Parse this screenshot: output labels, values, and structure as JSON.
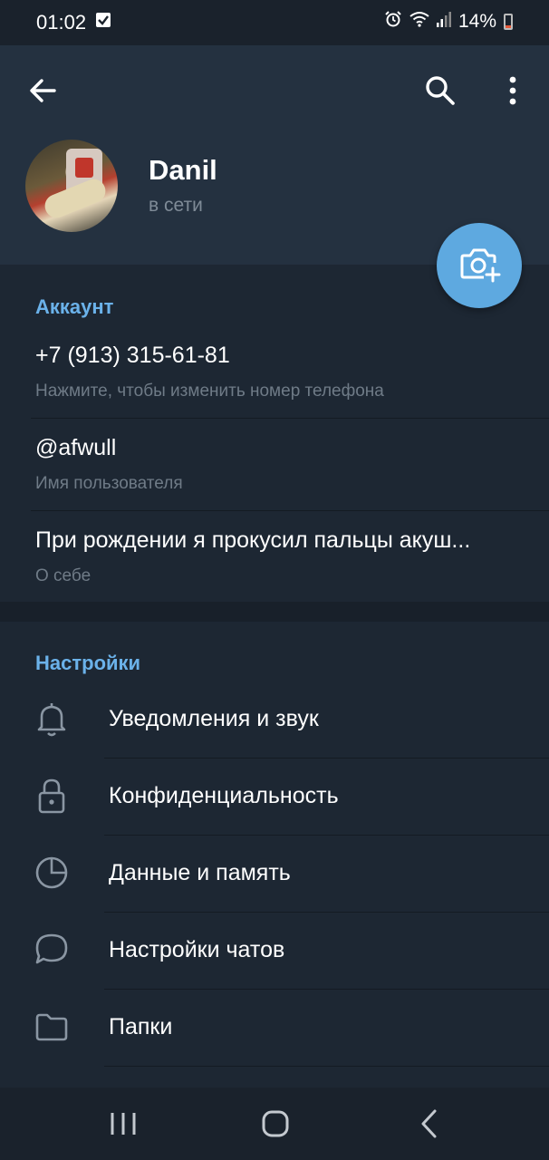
{
  "status_bar": {
    "time": "01:02",
    "battery": "14%",
    "icons": [
      "check-icon",
      "alarm-icon",
      "wifi-icon",
      "signal-icon",
      "battery-icon"
    ]
  },
  "header": {
    "icons": [
      "back-arrow-icon",
      "search-icon",
      "more-vert-icon"
    ],
    "name": "Danil",
    "status": "в сети",
    "fab_icon": "camera-add-icon"
  },
  "account": {
    "title": "Аккаунт",
    "rows": [
      {
        "value": "+7 (913) 315-61-81",
        "label": "Нажмите, чтобы изменить номер телефона"
      },
      {
        "value": "@afwull",
        "label": "Имя пользователя"
      },
      {
        "value": "При рождении я прокусил пальцы акуш...",
        "label": "О себе"
      }
    ]
  },
  "settings": {
    "title": "Настройки",
    "items": [
      {
        "label": "Уведомления и звук",
        "icon": "bell-icon"
      },
      {
        "label": "Конфиденциальность",
        "icon": "lock-icon"
      },
      {
        "label": "Данные и память",
        "icon": "pie-chart-icon"
      },
      {
        "label": "Настройки чатов",
        "icon": "chat-bubble-icon"
      },
      {
        "label": "Папки",
        "icon": "folder-icon"
      }
    ]
  },
  "nav_bar": {
    "icons": [
      "recent-apps-icon",
      "home-icon",
      "back-icon"
    ]
  },
  "colors": {
    "background": "#1d2733",
    "header": "#243140",
    "accent": "#6bb2ea",
    "fab": "#5ea9e0",
    "secondary_text": "#6f7b87"
  }
}
